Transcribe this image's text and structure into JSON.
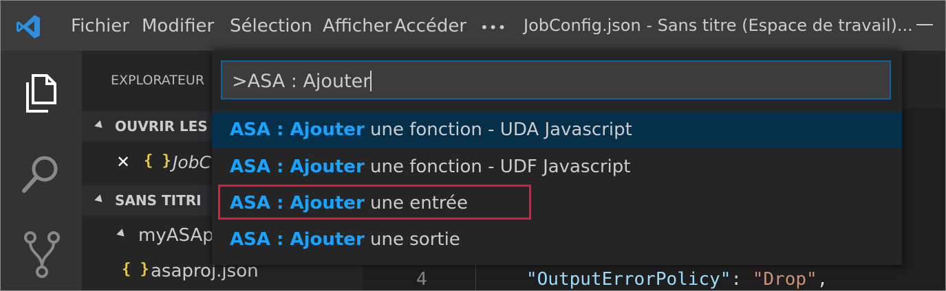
{
  "menu": {
    "file": "Fichier",
    "edit": "Modifier",
    "selection": "Sélection",
    "view": "Afficher",
    "go": "Accéder",
    "more": "•••"
  },
  "window_title": "JobConfig.json - Sans titre (Espace de travail)...",
  "sidebar": {
    "title": "EXPLORATEUR",
    "open_editors_header": "OUVRIR LES",
    "open_file_label": "JobC",
    "workspace_header": "SANS TITRI",
    "project_folder": "myASAp",
    "project_file": "asaproj.json",
    "braces_glyph": "{ }"
  },
  "palette": {
    "input_value": ">ASA : Ajouter",
    "items": [
      {
        "highlight": "ASA : Ajouter",
        "rest": " une fonction - UDA Javascript"
      },
      {
        "highlight": "ASA : Ajouter",
        "rest": " une fonction - UDF Javascript"
      },
      {
        "highlight": "ASA : Ajouter",
        "rest": " une entrée"
      },
      {
        "highlight": "ASA : Ajouter",
        "rest": " une sortie"
      }
    ]
  },
  "editor": {
    "line_number": "4",
    "code_key": "\"OutputErrorPolicy\"",
    "code_colon": ": ",
    "code_value": "\"Drop\"",
    "code_comma": ","
  },
  "colors": {
    "accent": "#18a3ff",
    "selected_item_bg": "#062f4a",
    "highlight_box": "#e31b3a",
    "titlebar_bg": "#3c3c3c",
    "activitybar_bg": "#333333"
  },
  "icons": [
    "vscode-logo-icon",
    "explorer-icon",
    "search-icon",
    "source-control-icon",
    "close-icon",
    "json-file-icon",
    "chevron-down-icon",
    "minimize-icon"
  ]
}
